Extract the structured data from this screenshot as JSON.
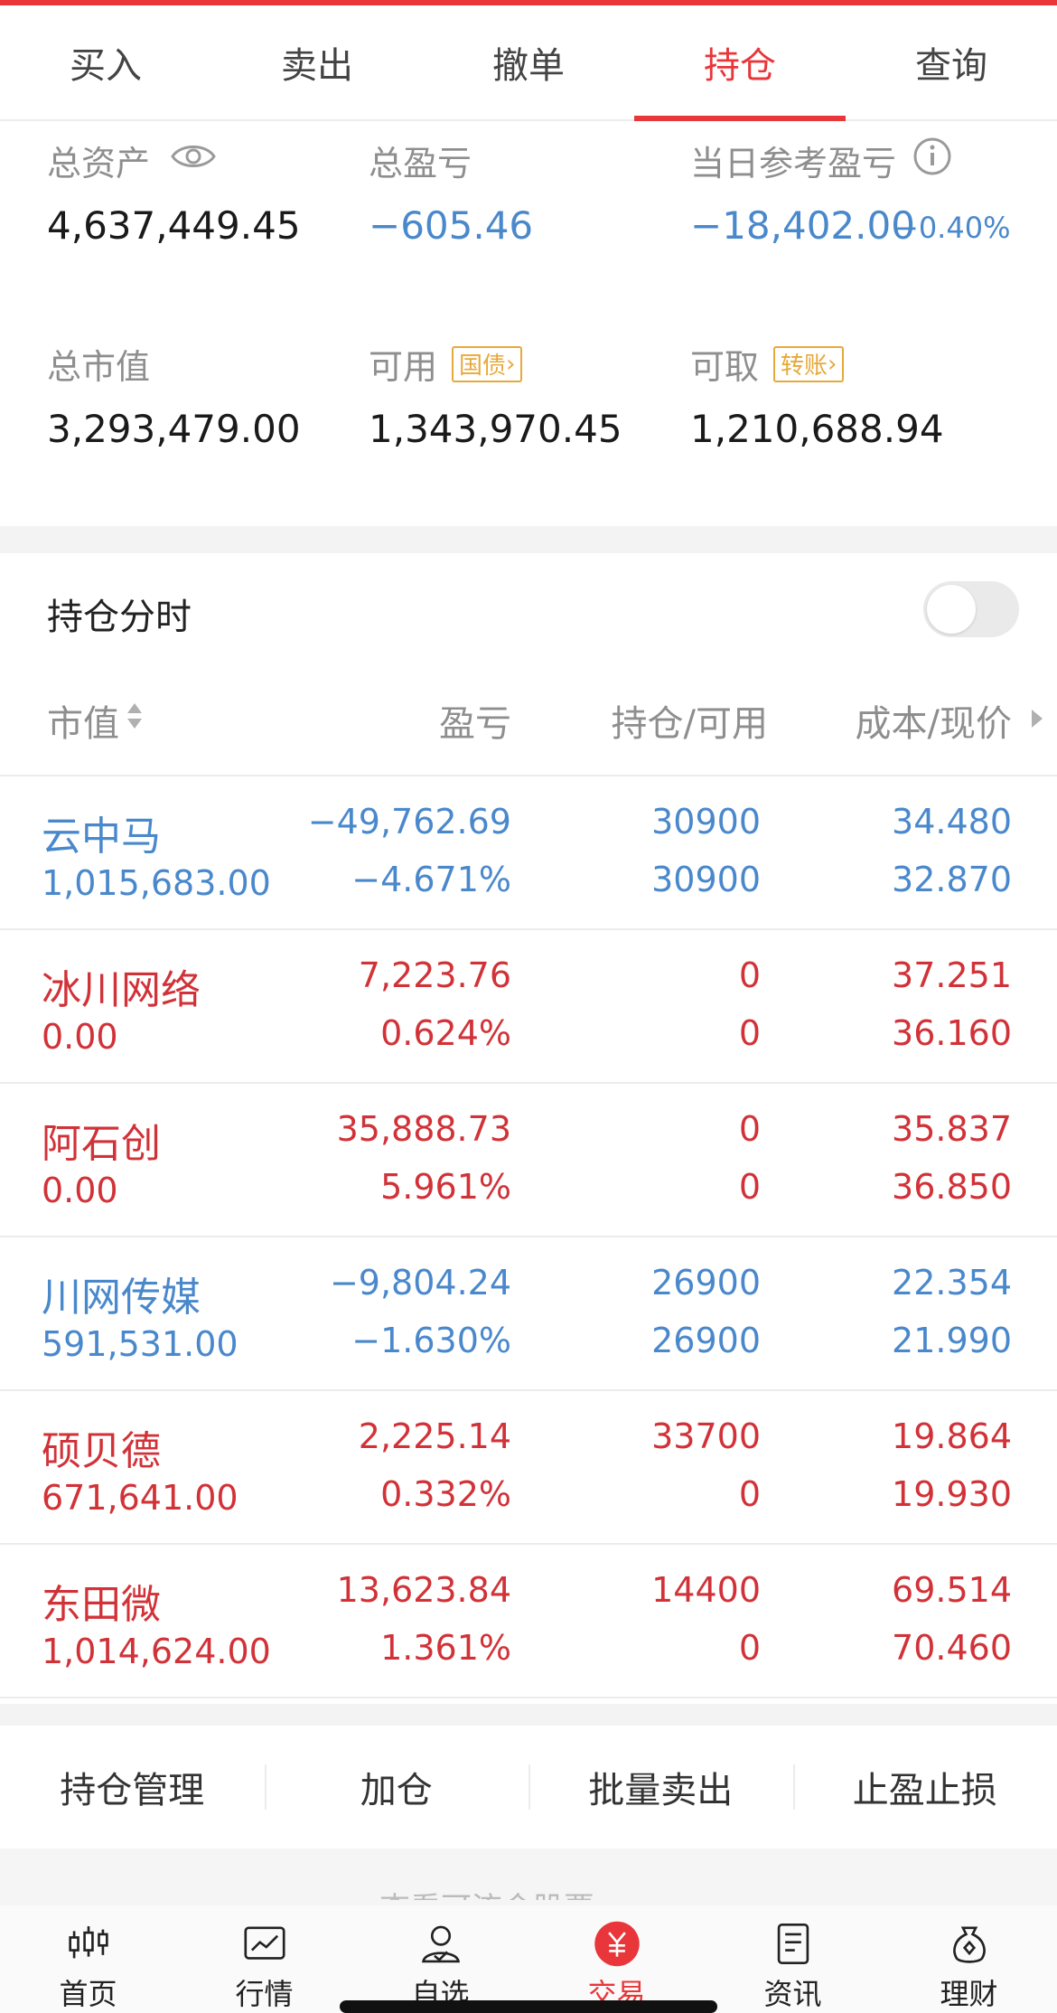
{
  "tabs": [
    {
      "label": "买入"
    },
    {
      "label": "卖出"
    },
    {
      "label": "撤单"
    },
    {
      "label": "持仓"
    },
    {
      "label": "查询"
    }
  ],
  "active_tab": "持仓",
  "summary": {
    "total_assets_label": "总资产",
    "total_assets": "4,637,449.45",
    "total_pl_label": "总盈亏",
    "total_pl": "−605.46",
    "daily_pl_label": "当日参考盈亏",
    "daily_pl": "−18,402.00",
    "daily_pl_pct": "−0.40%",
    "market_value_label": "总市值",
    "market_value": "3,293,479.00",
    "available_label": "可用",
    "available_tag": "国债",
    "available": "1,343,970.45",
    "withdrawable_label": "可取",
    "withdrawable_tag": "转账",
    "withdrawable": "1,210,688.94"
  },
  "section_title": "持仓分时",
  "columns": {
    "c1": "市值",
    "c2": "盈亏",
    "c3": "持仓/可用",
    "c4": "成本/现价"
  },
  "positions": [
    {
      "name": "云中马",
      "value": "1,015,683.00",
      "pl": "−49,762.69",
      "pl_pct": "−4.671%",
      "hold": "30900",
      "avail": "30900",
      "cost": "34.480",
      "price": "32.870",
      "trend": "down"
    },
    {
      "name": "冰川网络",
      "value": "0.00",
      "pl": "7,223.76",
      "pl_pct": "0.624%",
      "hold": "0",
      "avail": "0",
      "cost": "37.251",
      "price": "36.160",
      "trend": "up"
    },
    {
      "name": "阿石创",
      "value": "0.00",
      "pl": "35,888.73",
      "pl_pct": "5.961%",
      "hold": "0",
      "avail": "0",
      "cost": "35.837",
      "price": "36.850",
      "trend": "up"
    },
    {
      "name": "川网传媒",
      "value": "591,531.00",
      "pl": "−9,804.24",
      "pl_pct": "−1.630%",
      "hold": "26900",
      "avail": "26900",
      "cost": "22.354",
      "price": "21.990",
      "trend": "down"
    },
    {
      "name": "硕贝德",
      "value": "671,641.00",
      "pl": "2,225.14",
      "pl_pct": "0.332%",
      "hold": "33700",
      "avail": "0",
      "cost": "19.864",
      "price": "19.930",
      "trend": "up"
    },
    {
      "name": "东田微",
      "value": "1,014,624.00",
      "pl": "13,623.84",
      "pl_pct": "1.361%",
      "hold": "14400",
      "avail": "0",
      "cost": "69.514",
      "price": "70.460",
      "trend": "up"
    }
  ],
  "actions": [
    {
      "label": "持仓管理"
    },
    {
      "label": "加仓"
    },
    {
      "label": "批量卖出"
    },
    {
      "label": "止盈止损"
    }
  ],
  "partial_text": "查看可流金股票",
  "nav": [
    {
      "label": "首页",
      "icon": "candlestick-icon"
    },
    {
      "label": "行情",
      "icon": "chart-icon"
    },
    {
      "label": "自选",
      "icon": "user-check-icon"
    },
    {
      "label": "交易",
      "icon": "yuan-icon"
    },
    {
      "label": "资讯",
      "icon": "document-icon"
    },
    {
      "label": "理财",
      "icon": "money-bag-icon"
    }
  ],
  "colors": {
    "accent_red": "#e8363a",
    "up": "#d13238",
    "down": "#4a88cc",
    "tag": "#e6a93a"
  }
}
